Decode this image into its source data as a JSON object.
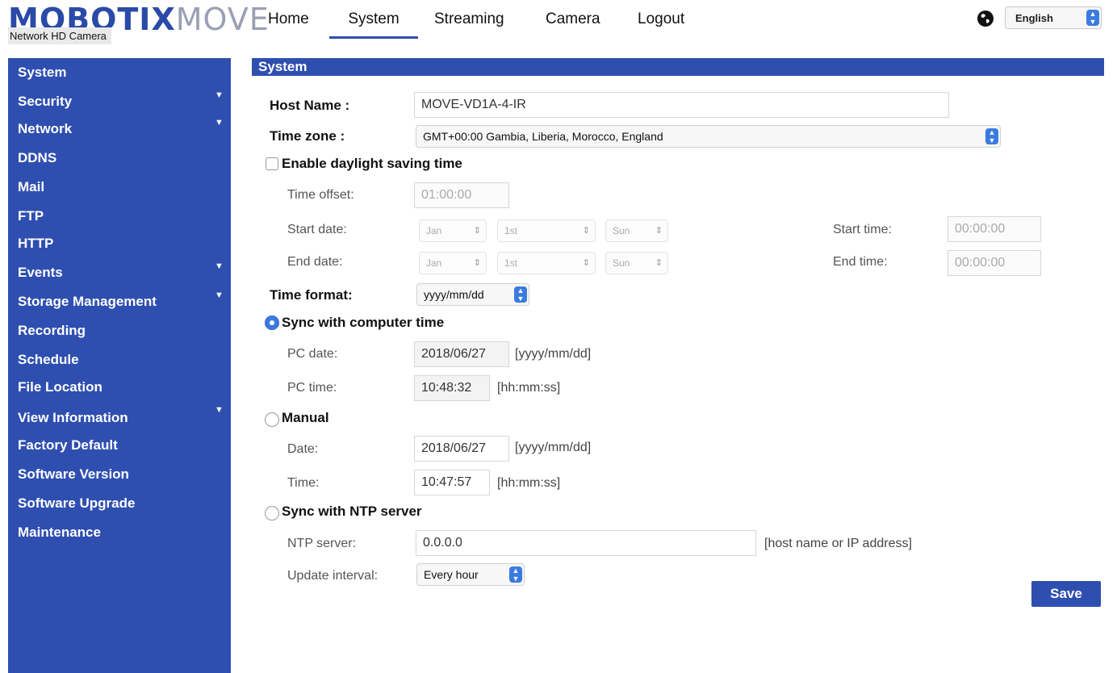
{
  "header": {
    "logo_main": "MOBOTIX",
    "logo_sub": "MOVE",
    "subtitle": "Network HD Camera",
    "nav": [
      "Home",
      "System",
      "Streaming",
      "Camera",
      "Logout"
    ],
    "active_nav": "System",
    "language": "English"
  },
  "sidebar": {
    "items": [
      {
        "label": "System",
        "expandable": false
      },
      {
        "label": "Security",
        "expandable": true
      },
      {
        "label": "Network",
        "expandable": true
      },
      {
        "label": "DDNS",
        "expandable": false
      },
      {
        "label": "Mail",
        "expandable": false
      },
      {
        "label": "FTP",
        "expandable": false
      },
      {
        "label": "HTTP",
        "expandable": false
      },
      {
        "label": "Events",
        "expandable": true
      },
      {
        "label": "Storage Management",
        "expandable": true
      },
      {
        "label": "Recording",
        "expandable": false
      },
      {
        "label": "Schedule",
        "expandable": false
      },
      {
        "label": "File Location",
        "expandable": false
      },
      {
        "label": "View Information",
        "expandable": true
      },
      {
        "label": "Factory Default",
        "expandable": false
      },
      {
        "label": "Software Version",
        "expandable": false
      },
      {
        "label": "Software Upgrade",
        "expandable": false
      },
      {
        "label": "Maintenance",
        "expandable": false
      }
    ]
  },
  "section": {
    "title": "System",
    "host_name_label": "Host Name :",
    "host_name_value": "MOVE-VD1A-4-IR",
    "time_zone_label": "Time zone :",
    "time_zone_value": "GMT+00:00 Gambia, Liberia, Morocco, England",
    "dst_label": "Enable daylight saving time",
    "time_offset_label": "Time offset:",
    "time_offset_value": "01:00:00",
    "start_date_label": "Start date:",
    "end_date_label": "End date:",
    "start_month": "Jan",
    "start_day": "1st",
    "start_weekday": "Sun",
    "end_month": "Jan",
    "end_day": "1st",
    "end_weekday": "Sun",
    "start_time_label": "Start time:",
    "start_time_value": "00:00:00",
    "end_time_label": "End time:",
    "end_time_value": "00:00:00",
    "time_format_label": "Time format:",
    "time_format_value": "yyyy/mm/dd",
    "sync_pc_label": "Sync with computer time",
    "pc_date_label": "PC date:",
    "pc_date_value": "2018/06/27",
    "pc_date_hint": "[yyyy/mm/dd]",
    "pc_time_label": "PC time:",
    "pc_time_value": "10:48:32",
    "pc_time_hint": "[hh:mm:ss]",
    "manual_label": "Manual",
    "date_label": "Date:",
    "date_value": "2018/06/27",
    "date_hint": "[yyyy/mm/dd]",
    "time_label": "Time:",
    "time_value": "10:47:57",
    "time_hint": "[hh:mm:ss]",
    "ntp_label": "Sync with NTP server",
    "ntp_server_label": "NTP server:",
    "ntp_server_value": "0.0.0.0",
    "ntp_server_hint": "[host name or IP address]",
    "update_interval_label": "Update interval:",
    "update_interval_value": "Every hour",
    "save_label": "Save"
  }
}
